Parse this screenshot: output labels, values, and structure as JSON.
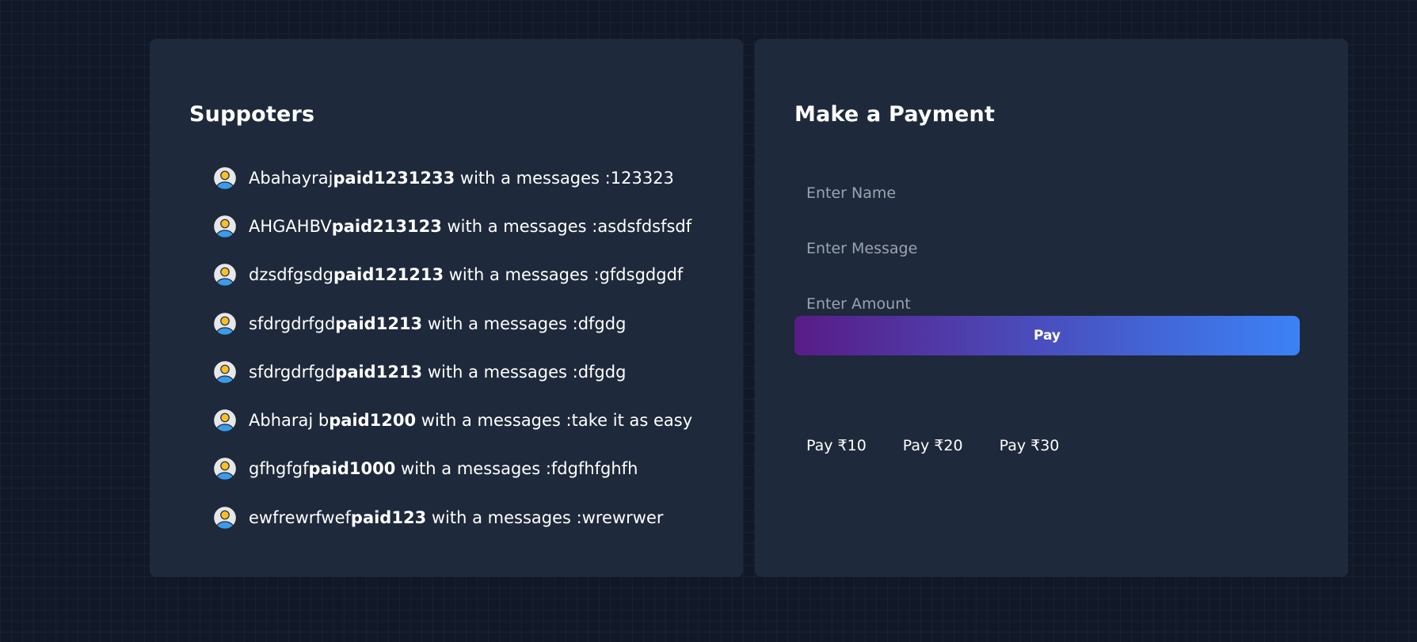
{
  "supporters_panel": {
    "title": "Suppoters",
    "avatar_icon": "user-avatar-icon",
    "rows": [
      {
        "name": "Abahayraj",
        "amount_text": "paid1231233",
        "message_text": " with a messages :123323"
      },
      {
        "name": "AHGAHBV",
        "amount_text": "paid213123",
        "message_text": " with a messages :asdsfdsfsdf"
      },
      {
        "name": "dzsdfgsdg",
        "amount_text": "paid121213",
        "message_text": " with a messages :gfdsgdgdf"
      },
      {
        "name": "sfdrgdrfgd",
        "amount_text": "paid1213",
        "message_text": " with a messages :dfgdg"
      },
      {
        "name": "sfdrgdrfgd",
        "amount_text": "paid1213",
        "message_text": " with a messages :dfgdg"
      },
      {
        "name": "Abharaj b",
        "amount_text": "paid1200",
        "message_text": " with a messages :take it as easy"
      },
      {
        "name": "gfhgfgf",
        "amount_text": "paid1000",
        "message_text": " with a messages :fdgfhfghfh"
      },
      {
        "name": "ewfrewrfwef",
        "amount_text": "paid123",
        "message_text": " with a messages :wrewrwer"
      }
    ]
  },
  "payment_panel": {
    "title": "Make a Payment",
    "name_field": {
      "placeholder": "Enter Name",
      "value": ""
    },
    "message_field": {
      "placeholder": "Enter Message",
      "value": ""
    },
    "amount_field": {
      "placeholder": "Enter Amount",
      "value": ""
    },
    "pay_button_label": "Pay",
    "quick_pay": [
      "Pay ₹10",
      "Pay ₹20",
      "Pay ₹30"
    ]
  },
  "colors": {
    "page_background": "#111827",
    "panel_background": "#1e293b",
    "pay_gradient_start": "#581c87",
    "pay_gradient_end": "#3b82f6",
    "placeholder": "#9ca3af"
  }
}
